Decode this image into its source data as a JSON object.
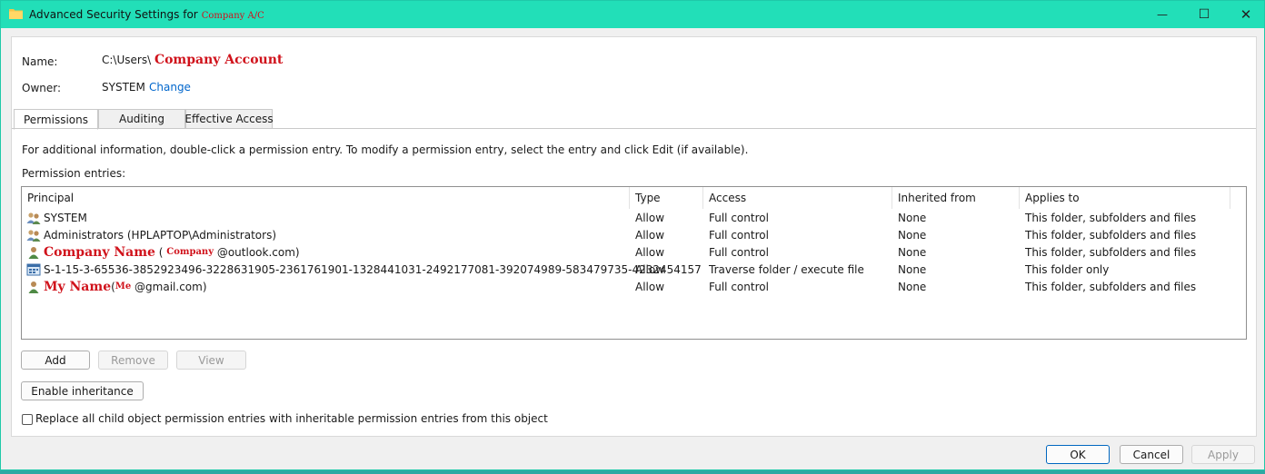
{
  "window": {
    "title": "Advanced Security Settings for",
    "title_redacted": "Company A/C",
    "min_glyph": "—",
    "max_glyph": "☐",
    "close_glyph": "✕"
  },
  "info": {
    "name_label": "Name:",
    "name_prefix": "C:\\Users\\",
    "name_redacted": "Company Account",
    "owner_label": "Owner:",
    "owner_value": "SYSTEM",
    "owner_change_link": "Change"
  },
  "tabs": [
    {
      "label": "Permissions",
      "active": true
    },
    {
      "label": "Auditing",
      "active": false
    },
    {
      "label": "Effective Access",
      "active": false
    }
  ],
  "instructions": "For additional information, double-click a permission entry. To modify a permission entry, select the entry and click Edit (if available).",
  "entries_label": "Permission entries:",
  "table": {
    "columns": [
      "Principal",
      "Type",
      "Access",
      "Inherited from",
      "Applies to"
    ],
    "rows": [
      {
        "icon": "group-icon",
        "principal": "SYSTEM",
        "type": "Allow",
        "access": "Full control",
        "inherited": "None",
        "applies": "This folder, subfolders and files"
      },
      {
        "icon": "group-icon",
        "principal": "Administrators (HPLAPTOP\\Administrators)",
        "type": "Allow",
        "access": "Full control",
        "inherited": "None",
        "applies": "This folder, subfolders and files"
      },
      {
        "icon": "user-icon",
        "principal_red": "Company Name",
        "principal_mid": " ( ",
        "principal_red2": "Company",
        "principal_suffix": " @outlook.com)",
        "type": "Allow",
        "access": "Full control",
        "inherited": "None",
        "applies": "This folder, subfolders and files"
      },
      {
        "icon": "app-package-icon",
        "principal": "S-1-15-3-65536-3852923496-3228631905-2361761901-1328441031-2492177081-392074989-583479735-4232454157",
        "type": "Allow",
        "access": "Traverse folder / execute file",
        "inherited": "None",
        "applies": "This folder only"
      },
      {
        "icon": "user-icon",
        "principal_red": "My Name",
        "principal_mid": "(",
        "principal_red2": "Me",
        "principal_suffix": " @gmail.com)",
        "type": "Allow",
        "access": "Full control",
        "inherited": "None",
        "applies": "This folder, subfolders and files"
      }
    ]
  },
  "buttons": {
    "add": "Add",
    "remove": "Remove",
    "view": "View",
    "enable_inheritance": "Enable inheritance",
    "ok": "OK",
    "cancel": "Cancel",
    "apply": "Apply"
  },
  "replace_checkbox_label": "Replace all child object permission entries with inheritable permission entries from this object",
  "colors": {
    "titlebar": "#22dfb8",
    "redaction": "#d0121b",
    "link": "#0066cc"
  }
}
